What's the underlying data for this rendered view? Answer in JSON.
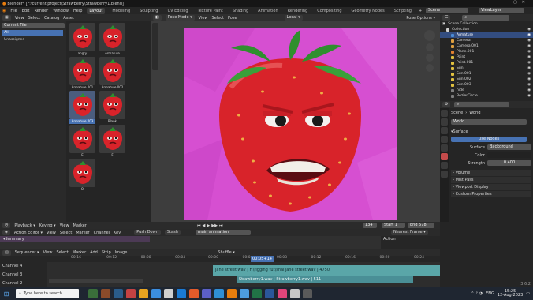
{
  "window": {
    "title": "Blender* [F:\\current project\\Strawberry\\Strawberry1.blend]"
  },
  "top_menu": [
    "File",
    "Edit",
    "Render",
    "Window",
    "Help"
  ],
  "workspaces": [
    "Layout",
    "Modeling",
    "Sculpting",
    "UV Editing",
    "Texture Paint",
    "Shading",
    "Animation",
    "Rendering",
    "Compositing",
    "Geometry Nodes",
    "Scripting"
  ],
  "active_workspace": "Layout",
  "scene_label": "Scene",
  "view_layer_label": "ViewLayer",
  "asset_browser": {
    "menus": [
      "View",
      "Select",
      "Catalog",
      "Asset"
    ],
    "library": "Current File",
    "catalogs": [
      "All",
      "Unassigned"
    ],
    "assets": [
      {
        "name": "angry"
      },
      {
        "name": "Armature"
      },
      {
        "name": "Armature.001"
      },
      {
        "name": "Armature.002"
      },
      {
        "name": "Armature.003",
        "selected": true
      },
      {
        "name": "Blank"
      },
      {
        "name": "E"
      },
      {
        "name": "F"
      },
      {
        "name": "O"
      }
    ]
  },
  "viewport": {
    "mode": "Pose Mode",
    "menus": [
      "View",
      "Select",
      "Pose"
    ],
    "orientation": "Local",
    "options": "Pose Options"
  },
  "outliner": {
    "title": "Scene Collection",
    "items": [
      {
        "name": "Collection",
        "color": "#d0d0d0"
      },
      {
        "name": "Armature",
        "color": "#4b8bd6",
        "selected": true
      },
      {
        "name": "Camera",
        "color": "#e0a040"
      },
      {
        "name": "Camera.001",
        "color": "#e0a040"
      },
      {
        "name": "Plane.001",
        "color": "#e08030"
      },
      {
        "name": "Point",
        "color": "#e0c040"
      },
      {
        "name": "Point.001",
        "color": "#e0c040"
      },
      {
        "name": "Sun",
        "color": "#e0c040"
      },
      {
        "name": "Sun.001",
        "color": "#e0c040"
      },
      {
        "name": "Sun.002",
        "color": "#e0c040"
      },
      {
        "name": "Sun.003",
        "color": "#e0c040"
      },
      {
        "name": "hide",
        "color": "#808080"
      },
      {
        "name": "BezierCircle",
        "color": "#808080"
      }
    ]
  },
  "properties": {
    "breadcrumb_scene": "Scene",
    "breadcrumb_world": "World",
    "world_name": "World",
    "surface_section": "Surface",
    "use_nodes": "Use Nodes",
    "surface_label": "Surface",
    "surface_value": "Background",
    "color_label": "Color",
    "strength_label": "Strength",
    "strength_value": "0.400",
    "sections": [
      "Volume",
      "Mist Pass",
      "Viewport Display",
      "Custom Properties"
    ]
  },
  "timeline": {
    "menus": [
      "Playback",
      "Keying",
      "View",
      "Marker"
    ],
    "current_frame": "134",
    "start_label": "Start",
    "start_value": "1",
    "end_label": "End",
    "end_value": "578"
  },
  "action_editor": {
    "mode": "Action Editor",
    "menus": [
      "View",
      "Select",
      "Marker",
      "Channel",
      "Key"
    ],
    "push_down": "Push Down",
    "stash": "Stash",
    "action": "main animation",
    "nearest_frame": "Nearest Frame",
    "summary": "Summary",
    "action_side": "Action"
  },
  "sequencer": {
    "mode": "Sequencer",
    "menus": [
      "View",
      "Select",
      "Marker",
      "Add",
      "Strip",
      "Image"
    ],
    "shuffle": "Shuffle",
    "ticks": [
      "00:16",
      "-00:12",
      "-00:08",
      "-00:04",
      "00:00",
      "00:04",
      "00:08",
      "00:12",
      "00:16",
      "00:20",
      "00:24"
    ],
    "current_time": "00:05+14",
    "channels": [
      "Channel 4",
      "Channel 3",
      "Channel 2"
    ],
    "strip_audio": "jane street.wav | F:\\rigging tut\\shalljane street.wav | 4750",
    "strip_video": "Strawberry1.wav | Strawberry1.wav | 511"
  },
  "version": "3.6.2",
  "taskbar": {
    "search_placeholder": "Type here to search",
    "lang": "ENG",
    "time": "15:25",
    "date": "12-Aug-2023"
  },
  "colors": {
    "magenta_bg": "#d64fd1",
    "strawberry": "#d8232a",
    "leaf": "#2f8f2e",
    "accent": "#4772b3",
    "strip_teal": "#4a8f96",
    "strip_audio": "#5aa6a8"
  }
}
